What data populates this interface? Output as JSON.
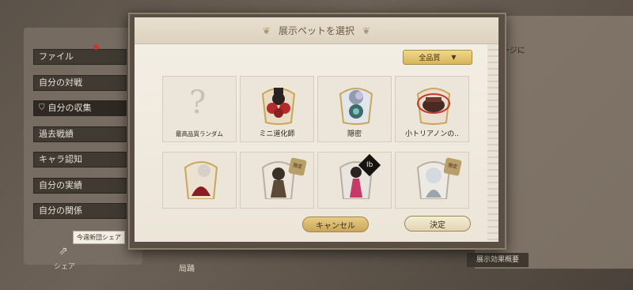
{
  "background": {
    "side_menu": [
      {
        "label": "ファイル",
        "icon": ""
      },
      {
        "label": "自分の対戦",
        "icon": ""
      },
      {
        "label": "自分の収集",
        "icon": "shield-icon"
      },
      {
        "label": "過去戦績",
        "icon": ""
      },
      {
        "label": "キャラ認知",
        "icon": ""
      },
      {
        "label": "自分の実績",
        "icon": ""
      },
      {
        "label": "自分の関係",
        "icon": ""
      }
    ],
    "share_tip": "今週新団シェア",
    "share_label": "シェア",
    "right_text": "ージに",
    "bottom_text": "局踊",
    "bottom_button": "展示効果概要"
  },
  "modal": {
    "title": "展示ペットを選択",
    "filter": {
      "selected": "全品質",
      "icon": "chevron-down-icon"
    },
    "pets": [
      {
        "caption": "最高品質ランダム",
        "kind": "random"
      },
      {
        "caption": "ミニ道化師",
        "kind": "pet"
      },
      {
        "caption": "隠密",
        "kind": "pet"
      },
      {
        "caption": "小トリアノンの..",
        "kind": "pet"
      },
      {
        "caption": "",
        "kind": "pet"
      },
      {
        "caption": "",
        "kind": "pet",
        "badge": "限定"
      },
      {
        "caption": "",
        "kind": "pet",
        "badge": "Ib"
      },
      {
        "caption": "",
        "kind": "pet",
        "badge": "限定"
      }
    ],
    "cancel_label": "キャンセル",
    "confirm_label": "決定"
  },
  "colors": {
    "accent_gold": "#d8b55a",
    "paper": "#f4efe6",
    "dark": "#403a33"
  }
}
